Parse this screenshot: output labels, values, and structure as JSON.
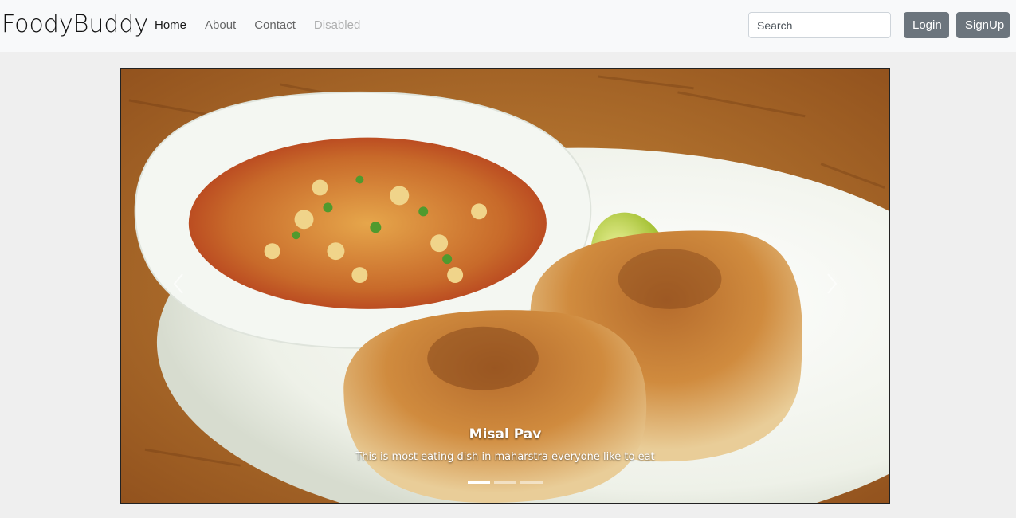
{
  "navbar": {
    "brand": "FoodyBuddy",
    "links": [
      {
        "label": "Home",
        "state": "active"
      },
      {
        "label": "About",
        "state": "normal"
      },
      {
        "label": "Contact",
        "state": "normal"
      },
      {
        "label": "Disabled",
        "state": "disabled"
      }
    ],
    "search_placeholder": "Search",
    "login_label": "Login",
    "signup_label": "SignUp"
  },
  "carousel": {
    "caption_title": "Misal Pav",
    "caption_text": "This is most eating dish in maharstra everyone like to eat",
    "slide_count": 3,
    "active_slide": 1,
    "prev_icon": "chevron-left-icon",
    "next_icon": "chevron-right-icon"
  },
  "colors": {
    "navbar_bg": "#f8f9fa",
    "button_bg": "#6c757d",
    "page_bg": "#efefef"
  }
}
